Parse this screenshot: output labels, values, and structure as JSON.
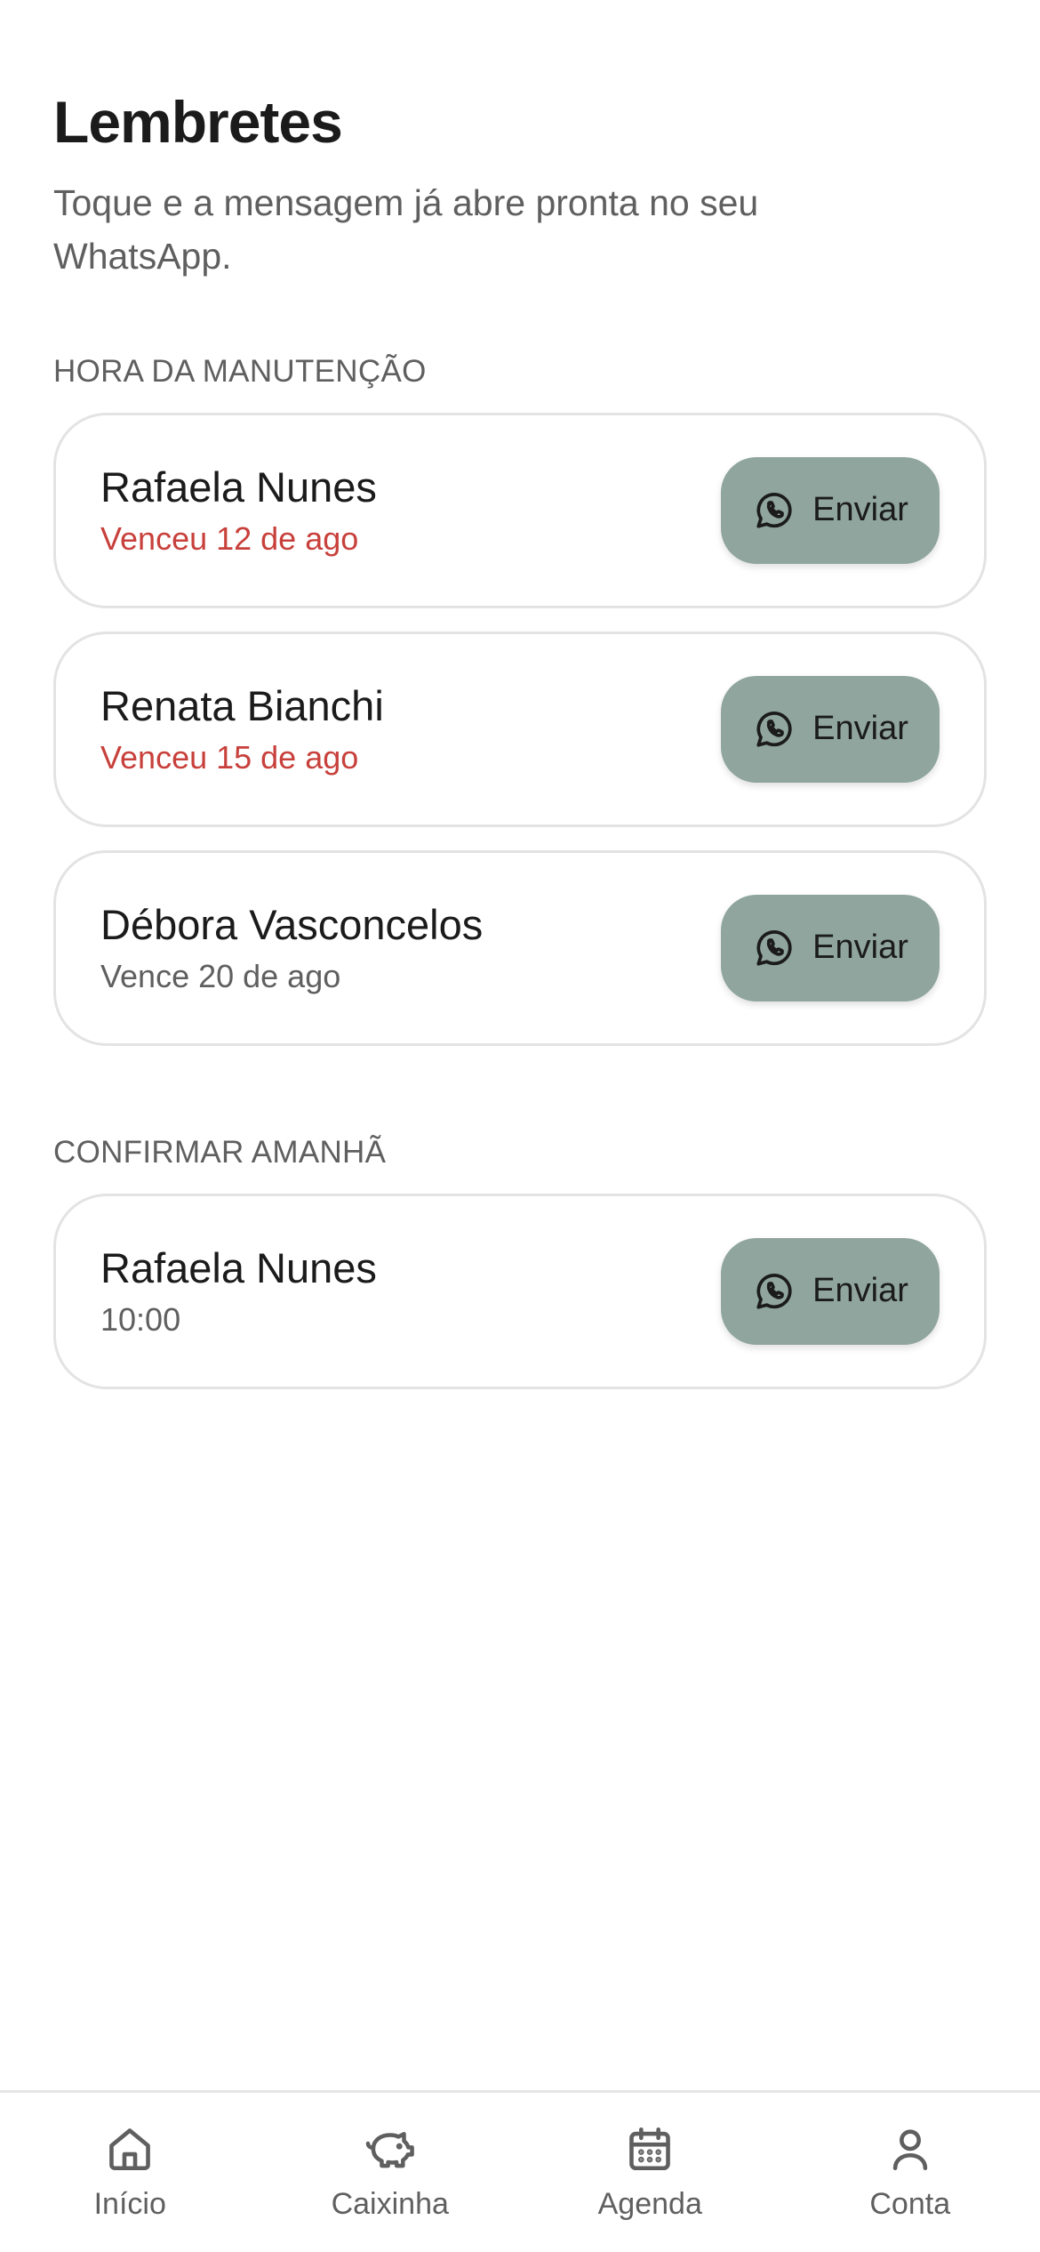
{
  "header": {
    "title": "Lembretes",
    "subtitle": "Toque e a mensagem já abre pronta no seu WhatsApp."
  },
  "sections": [
    {
      "label": "HORA DA MANUTENÇÃO",
      "items": [
        {
          "name": "Rafaela Nunes",
          "detail": "Venceu 12 de ago",
          "status": "overdue",
          "button_label": "Enviar"
        },
        {
          "name": "Renata Bianchi",
          "detail": "Venceu 15 de ago",
          "status": "overdue",
          "button_label": "Enviar"
        },
        {
          "name": "Débora Vasconcelos",
          "detail": "Vence 20 de ago",
          "status": "upcoming",
          "button_label": "Enviar"
        }
      ]
    },
    {
      "label": "CONFIRMAR AMANHÃ",
      "items": [
        {
          "name": "Rafaela Nunes",
          "detail": "10:00",
          "status": "upcoming",
          "button_label": "Enviar"
        }
      ]
    }
  ],
  "send_icon": "whatsapp-icon",
  "nav": {
    "items": [
      {
        "label": "Início",
        "icon": "home-icon"
      },
      {
        "label": "Caixinha",
        "icon": "piggy-bank-icon"
      },
      {
        "label": "Agenda",
        "icon": "calendar-icon"
      },
      {
        "label": "Conta",
        "icon": "user-icon"
      }
    ]
  },
  "colors": {
    "button_bg": "#8fa59e",
    "overdue_text": "#c8403b",
    "muted_text": "#5f5f5f",
    "card_border": "#e3e3e3"
  }
}
